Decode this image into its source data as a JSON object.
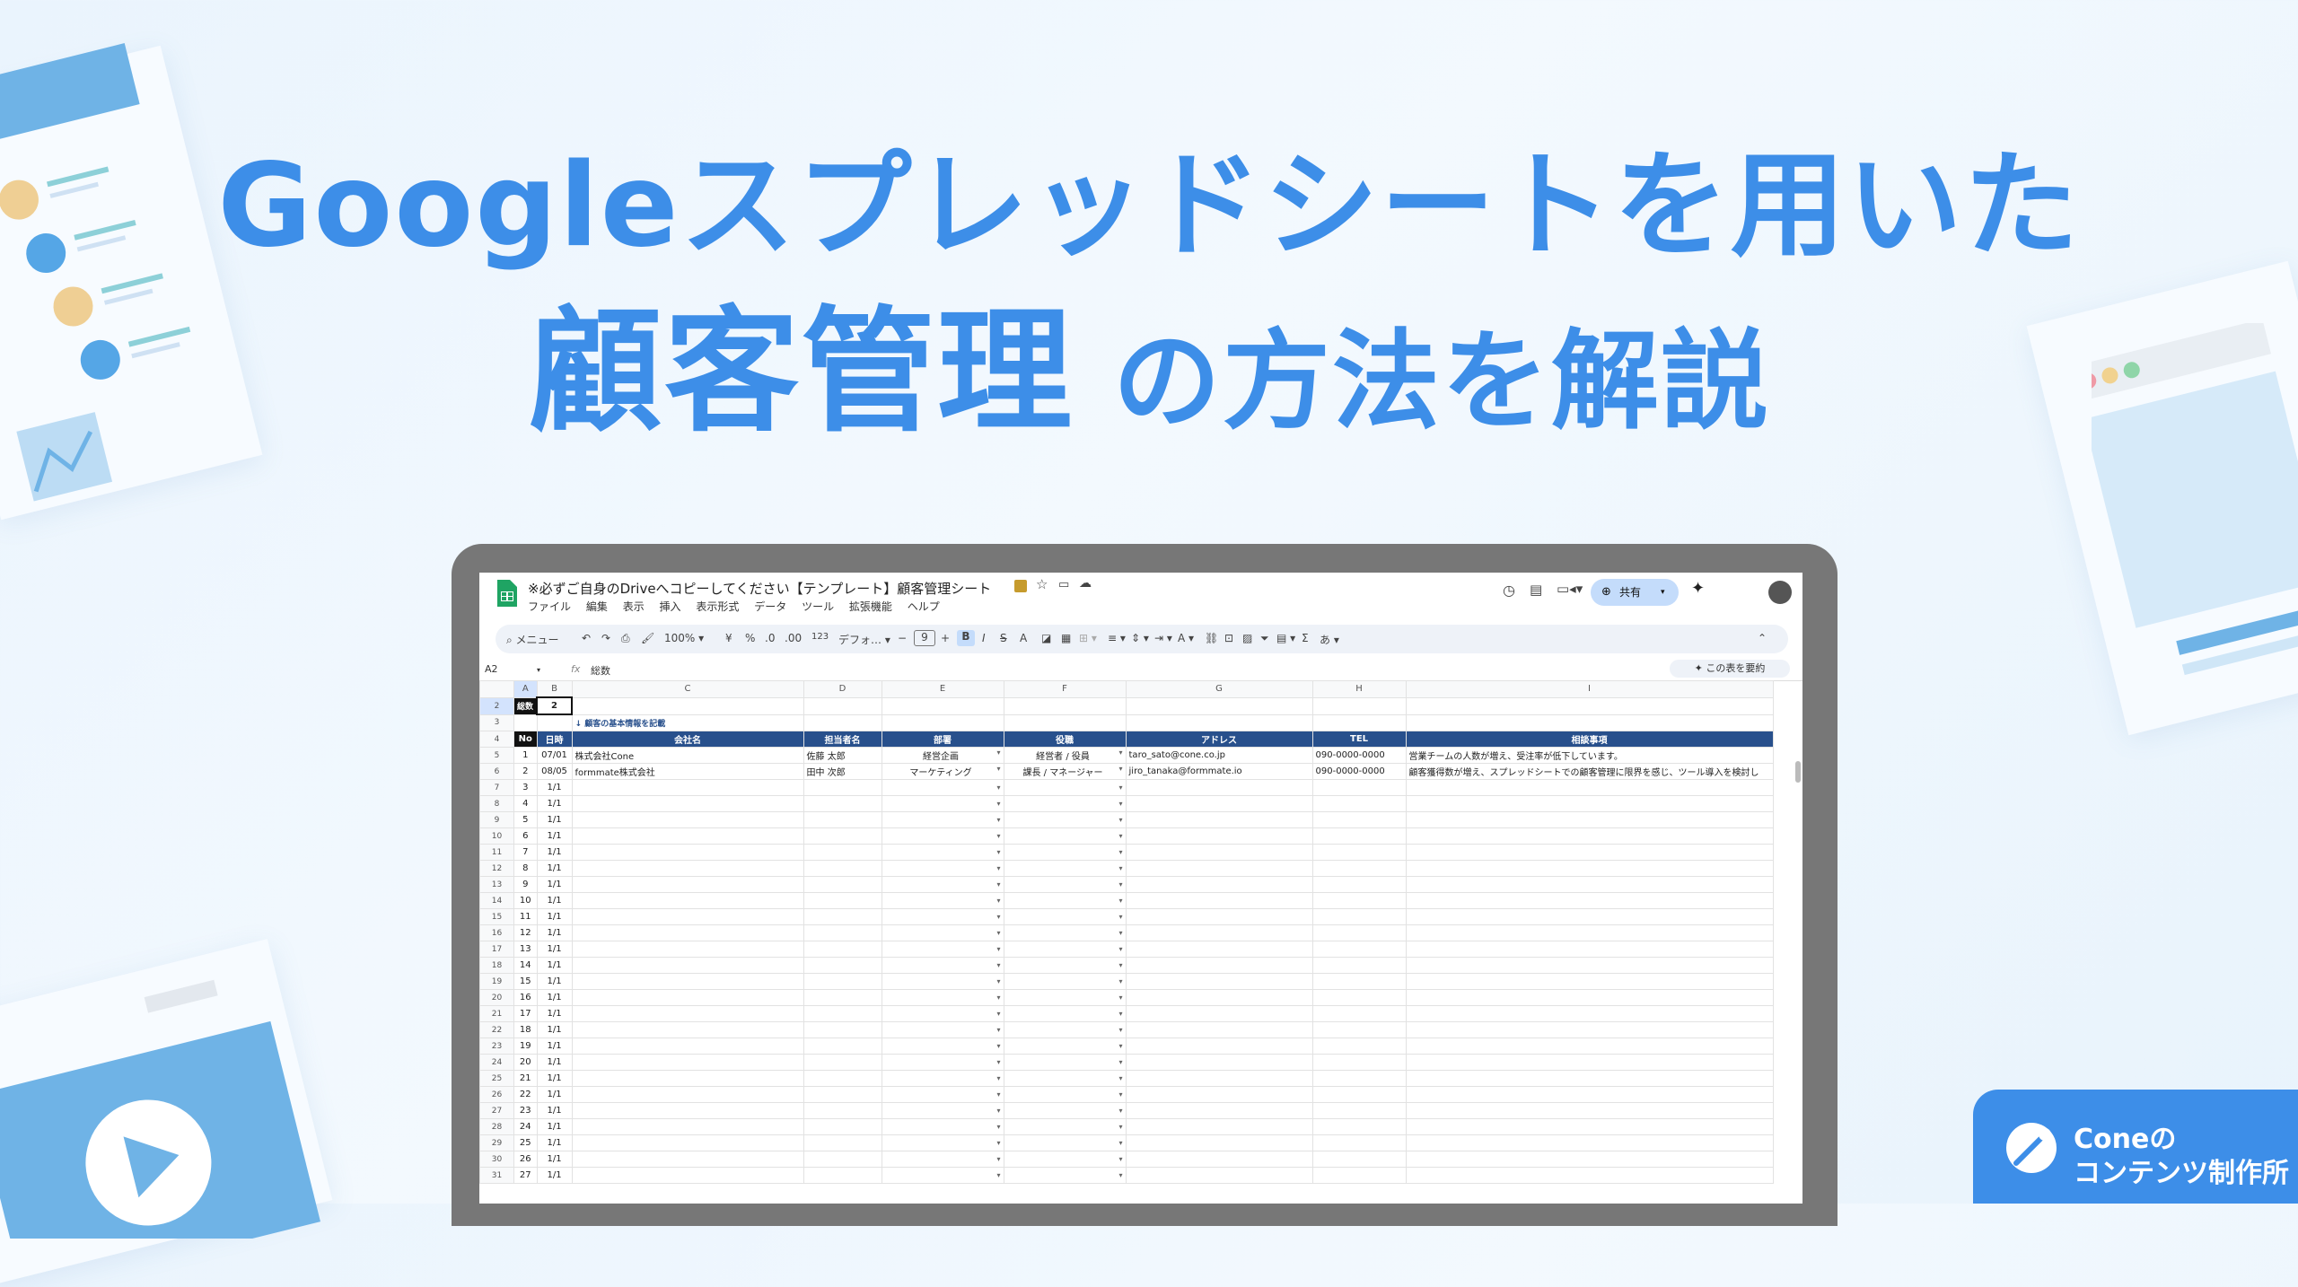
{
  "headline": {
    "line1": "Googleスプレッドシートを用いた",
    "line2_main": "顧客管理",
    "line2_rest": " の方法を解説"
  },
  "app": {
    "title": "※必ずご自身のDriveへコピーしてください【テンプレート】顧客管理シート",
    "menu": [
      "ファイル",
      "編集",
      "表示",
      "挿入",
      "表示形式",
      "データ",
      "ツール",
      "拡張機能",
      "ヘルプ"
    ],
    "share_label": "共有",
    "search_label": "メニュー",
    "zoom": "100%",
    "currency": "¥",
    "percent": "%",
    "decimal_less": ".0",
    "decimal_more": ".00",
    "number_format": "123",
    "font_name": "デフォ…",
    "font_size": "9",
    "bold": "B",
    "italic": "I",
    "strike": "S",
    "text_color": "A",
    "sum": "Σ",
    "input_mode": "あ",
    "cell_ref": "A2",
    "fx": "fx",
    "formula_value": "総数",
    "summarize_label": "この表を要約",
    "columns": [
      "A",
      "B",
      "C",
      "D",
      "E",
      "F",
      "G",
      "H",
      "I"
    ]
  },
  "sheet": {
    "count_label": "総数",
    "count_value": "2",
    "section_note": "↓ 顧客の基本情報を記載",
    "headers": [
      "No",
      "日時",
      "会社名",
      "担当者名",
      "部署",
      "役職",
      "アドレス",
      "TEL",
      "相談事項"
    ],
    "rows": [
      {
        "r": "5",
        "no": "1",
        "date": "07/01",
        "company": "株式会社Cone",
        "person": "佐藤 太郎",
        "dept": "経営企画",
        "role": "経営者 / 役員",
        "email": "taro_sato@cone.co.jp",
        "tel": "090-0000-0000",
        "note": "営業チームの人数が増え、受注率が低下しています。"
      },
      {
        "r": "6",
        "no": "2",
        "date": "08/05",
        "company": "formmate株式会社",
        "person": "田中 次郎",
        "dept": "マーケティング",
        "role": "課長 / マネージャー",
        "email": "jiro_tanaka@formmate.io",
        "tel": "090-0000-0000",
        "note": "顧客獲得数が増え、スプレッドシートでの顧客管理に限界を感じ、ツール導入を検討し"
      }
    ],
    "empty_rows": [
      [
        "7",
        "3"
      ],
      [
        "8",
        "4"
      ],
      [
        "9",
        "5"
      ],
      [
        "10",
        "6"
      ],
      [
        "11",
        "7"
      ],
      [
        "12",
        "8"
      ],
      [
        "13",
        "9"
      ],
      [
        "14",
        "10"
      ],
      [
        "15",
        "11"
      ],
      [
        "16",
        "12"
      ],
      [
        "17",
        "13"
      ],
      [
        "18",
        "14"
      ],
      [
        "19",
        "15"
      ],
      [
        "20",
        "16"
      ],
      [
        "21",
        "17"
      ],
      [
        "22",
        "18"
      ],
      [
        "23",
        "19"
      ],
      [
        "24",
        "20"
      ],
      [
        "25",
        "21"
      ],
      [
        "26",
        "22"
      ],
      [
        "27",
        "23"
      ],
      [
        "28",
        "24"
      ],
      [
        "29",
        "25"
      ],
      [
        "30",
        "26"
      ],
      [
        "31",
        "27"
      ]
    ],
    "empty_date": "1/1"
  },
  "brand": {
    "line1": "Coneの",
    "line2": "コンテンツ制作所"
  },
  "colors": {
    "accent": "#3d8ee8",
    "header_bg": "#28508c"
  }
}
